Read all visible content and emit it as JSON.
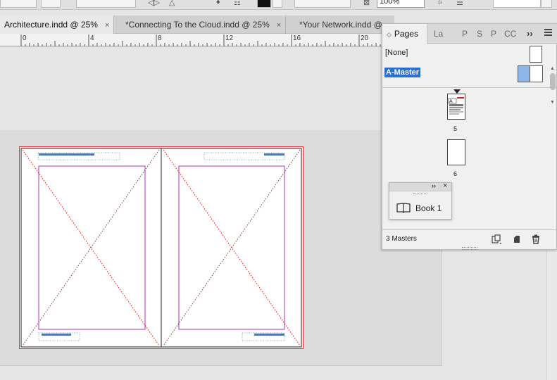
{
  "control_bar": {
    "zoom_value": "100%"
  },
  "tabs": [
    {
      "label": "Architecture.indd @ 25%",
      "close": "×"
    },
    {
      "label": "*Connecting To the Cloud.indd @ 25%",
      "close": "×"
    },
    {
      "label": "*Your Network.indd @",
      "close": ""
    }
  ],
  "ruler": {
    "labels": [
      "0",
      "4",
      "8",
      "12",
      "16",
      "20"
    ]
  },
  "pages_panel": {
    "active_tab": "Pages",
    "other_tabs": [
      "La",
      "P",
      "S",
      "P",
      "CC"
    ],
    "masters": {
      "none_label": "[None]",
      "a_master_label": "A-Master"
    },
    "page_numbers": [
      "5",
      "6"
    ],
    "status": "3 Masters"
  },
  "book_panel": {
    "label": "Book 1"
  }
}
